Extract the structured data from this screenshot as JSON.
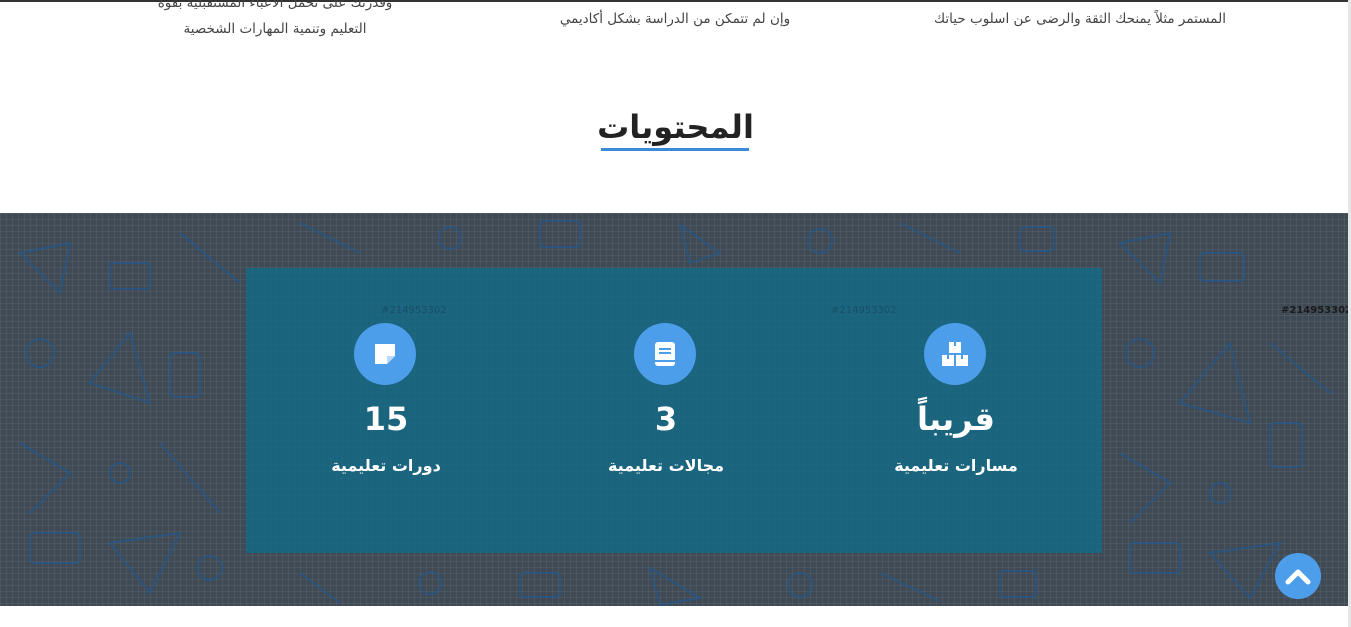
{
  "features": [
    {
      "text": "وقدرتك على تحمل الاعباء المستقبلية بقوة التعليم وتنمية المهارات الشخصية"
    },
    {
      "text": "وإن لم تتمكن من الدراسة بشكل أكاديمي"
    },
    {
      "text": "المستمر مثلاً يمنحك الثقة والرضى عن اسلوب حياتك"
    }
  ],
  "section": {
    "title": "المحتويات"
  },
  "watermark": "#214953302",
  "stats": [
    {
      "value": "15",
      "label": "دورات تعليمية",
      "icon": "sticky-note-icon"
    },
    {
      "value": "3",
      "label": "مجالات تعليمية",
      "icon": "book-icon"
    },
    {
      "value": "قريباً",
      "label": "مسارات تعليمية",
      "icon": "boxes-icon"
    }
  ],
  "colors": {
    "accent": "#4c9eea",
    "panel": "#126a87",
    "band": "#3f4a55"
  },
  "back_to_top": {
    "icon": "chevron-up-icon"
  }
}
